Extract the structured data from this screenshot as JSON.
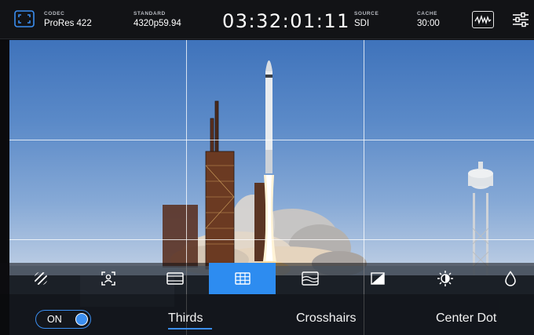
{
  "status_bar": {
    "codec": {
      "label": "CODEC",
      "value": "ProRes 422"
    },
    "standard": {
      "label": "STANDARD",
      "value": "4320p59.94"
    },
    "timecode": "03:32:01:11",
    "source": {
      "label": "SOURCE",
      "value": "SDI"
    },
    "cache": {
      "label": "CACHE",
      "value": "30:00"
    },
    "icons": [
      "fullscreen-icon",
      "waveform-scope-icon",
      "settings-sliders-icon"
    ]
  },
  "grid_overlay": {
    "mode": "thirds",
    "color": "#ffffff"
  },
  "tools": [
    {
      "icon": "zebra-icon",
      "active": false
    },
    {
      "icon": "focus-assist-icon",
      "active": false
    },
    {
      "icon": "frame-guides-icon",
      "active": false
    },
    {
      "icon": "grid-icon",
      "active": true
    },
    {
      "icon": "false-color-icon",
      "active": false
    },
    {
      "icon": "contrast-icon",
      "active": false
    },
    {
      "icon": "brightness-icon",
      "active": false
    },
    {
      "icon": "saturation-drop-icon",
      "active": false
    }
  ],
  "options": {
    "toggle_label": "ON",
    "toggle_on": true,
    "items": [
      "Thirds",
      "Crosshairs",
      "Center Dot"
    ],
    "selected": "Thirds"
  },
  "colors": {
    "accent": "#2d8cf0",
    "bar_bg": "#121316"
  }
}
